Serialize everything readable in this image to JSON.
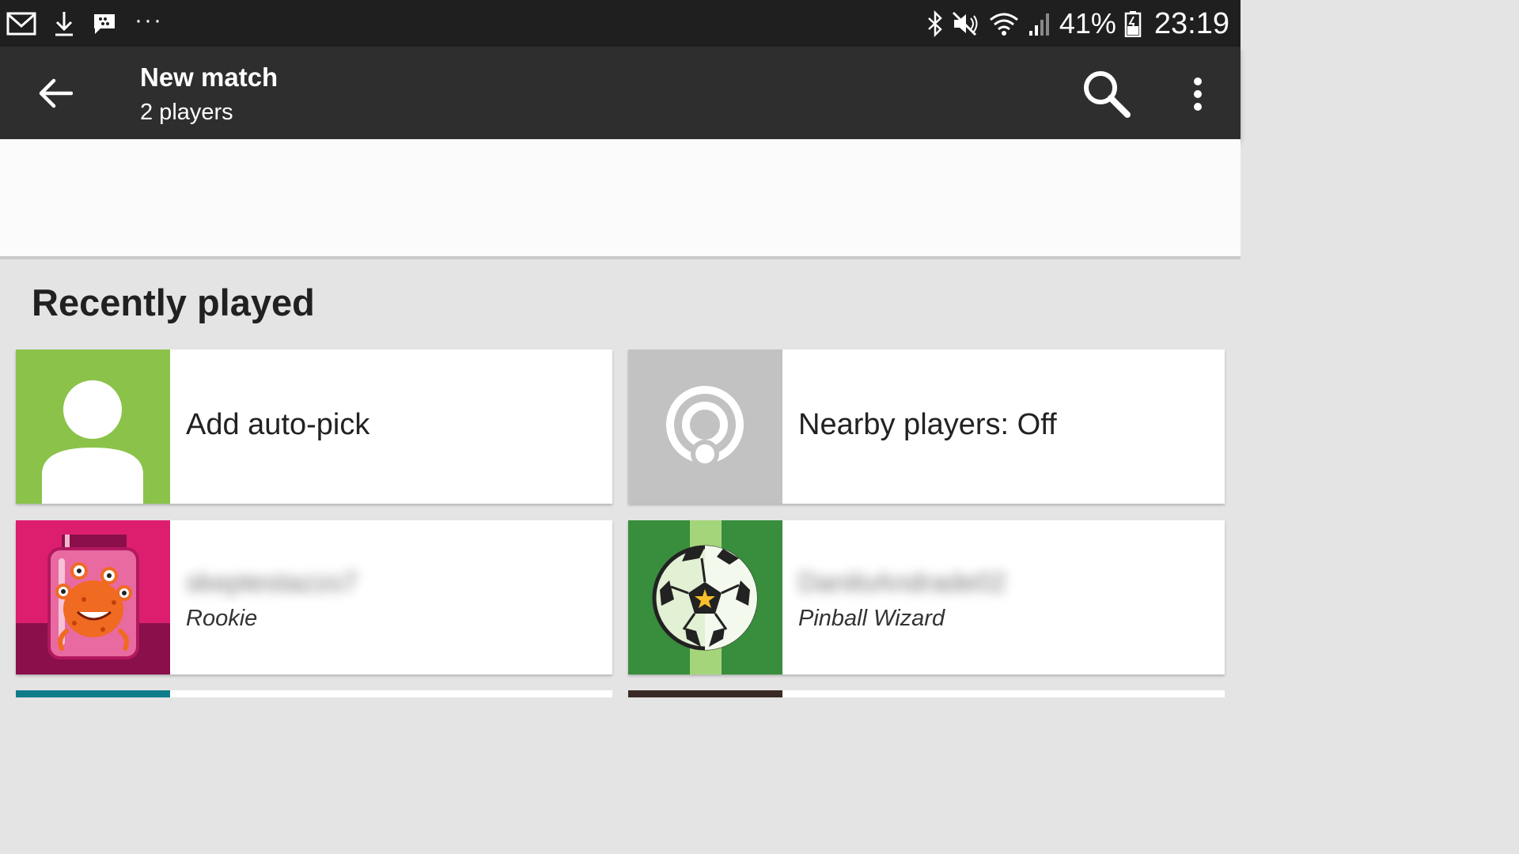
{
  "status_bar": {
    "battery": "41%",
    "time": "23:19",
    "more": "···"
  },
  "app_bar": {
    "title": "New match",
    "subtitle": "2 players"
  },
  "recently_played": {
    "heading": "Recently played",
    "auto_pick_label": "Add auto-pick",
    "nearby_label": "Nearby players: Off",
    "players": [
      {
        "name": "skeptestazzo7",
        "rank": "Rookie"
      },
      {
        "name": "DaniloAndrade02",
        "rank": "Pinball Wizard"
      }
    ]
  },
  "colors": {
    "status_bar": "#1f1f1f",
    "app_bar": "#2e2e2e",
    "auto_pick_tile": "#8bc34a",
    "nearby_tile": "#c2c2c2",
    "player1_tile": "#dd1e6f",
    "player2_tile": "#388e3c"
  },
  "icons": [
    "gmail-icon",
    "download-icon",
    "bbm-icon",
    "bluetooth-icon",
    "mute-icon",
    "wifi-icon",
    "signal-icon",
    "battery-icon",
    "back-arrow-icon",
    "search-icon",
    "more-vert-icon",
    "person-icon",
    "nearby-icon",
    "monster-jar-avatar",
    "soccer-ball-avatar"
  ]
}
